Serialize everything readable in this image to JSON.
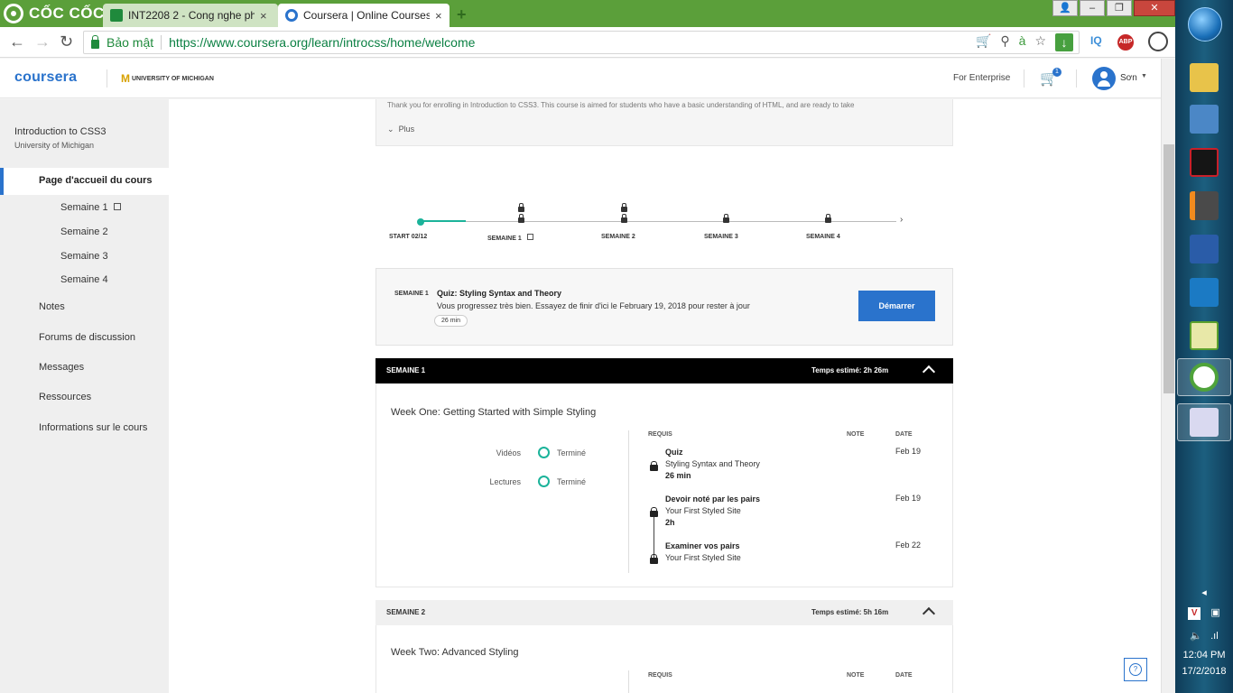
{
  "browser": {
    "brand": "CỐC CỐC",
    "tabs": [
      {
        "label": "INT2208 2 - Cong nghe ph"
      },
      {
        "label": "Coursera | Online Courses"
      }
    ],
    "secure_label": "Bảo mật",
    "url": "https://www.coursera.org/learn/introcss/home/welcome",
    "extensions": [
      "IQ",
      "ABP"
    ]
  },
  "header": {
    "logo": "coursera",
    "partner": "UNIVERSITY OF MICHIGAN",
    "for_enterprise": "For Enterprise",
    "cart_count": "1",
    "user_name": "Sơn"
  },
  "sidebar": {
    "course_title": "Introduction to CSS3",
    "course_university": "University of Michigan",
    "home": "Page d'accueil du cours",
    "weeks": [
      "Semaine 1",
      "Semaine 2",
      "Semaine 3",
      "Semaine 4"
    ],
    "items": [
      "Notes",
      "Forums de discussion",
      "Messages",
      "Ressources",
      "Informations sur le cours"
    ]
  },
  "intro": {
    "text": "Thank you for enrolling in Introduction to CSS3. This course is aimed for students who have a basic understanding of HTML, and are ready to take",
    "more": "Plus"
  },
  "timeline": {
    "start": "START 02/12",
    "weeks": [
      "SEMAINE 1",
      "SEMAINE 2",
      "SEMAINE 3",
      "SEMAINE 4"
    ]
  },
  "next_up": {
    "week": "SEMAINE 1",
    "title": "Quiz: Styling Syntax and Theory",
    "description": "Vous progressez très bien. Essayez de finir d'ici le February 19, 2018 pour rester à jour",
    "duration": "26 min",
    "button": "Démarrer"
  },
  "week1": {
    "label": "SEMAINE 1",
    "estimate": "Temps estimé: 2h 26m",
    "title": "Week One: Getting Started with Simple Styling",
    "progress": [
      {
        "label": "Vidéos",
        "status": "Terminé"
      },
      {
        "label": "Lectures",
        "status": "Terminé"
      }
    ],
    "columns": {
      "required": "REQUIS",
      "grade": "NOTE",
      "date": "DATE"
    },
    "items": [
      {
        "type": "Quiz",
        "name": "Styling Syntax and Theory",
        "duration": "26 min",
        "date": "Feb 19"
      },
      {
        "type": "Devoir noté par les pairs",
        "name": "Your First Styled Site",
        "duration": "2h",
        "date": "Feb 19"
      },
      {
        "type": "Examiner vos pairs",
        "name": "Your First Styled Site",
        "date": "Feb 22"
      }
    ]
  },
  "week2": {
    "label": "SEMAINE 2",
    "estimate": "Temps estimé: 5h 16m",
    "title": "Week Two: Advanced Styling",
    "columns": {
      "required": "REQUIS",
      "grade": "NOTE",
      "date": "DATE"
    }
  },
  "help_label": "?",
  "taskbar": {
    "time": "12:04 PM",
    "date": "17/2/2018",
    "apps": [
      "computer",
      "garena",
      "sublime",
      "devcpp",
      "vscode",
      "notepadpp",
      "coccoc",
      "paint"
    ]
  },
  "colors": {
    "accent": "#2a73cc",
    "progress": "#1bb39a",
    "browser_green": "#5b9f3a"
  }
}
